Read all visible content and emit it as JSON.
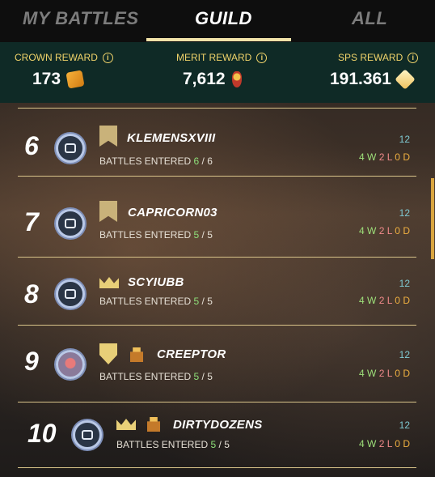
{
  "tabs": {
    "my_battles": "MY BATTLES",
    "guild": "GUILD",
    "all": "ALL",
    "active": "GUILD"
  },
  "rewards": {
    "crown": {
      "label": "CROWN REWARD",
      "value": "173",
      "icon": "crown-token-icon"
    },
    "merit": {
      "label": "MERIT REWARD",
      "value": "7,612",
      "icon": "merit-medal-icon"
    },
    "sps": {
      "label": "SPS REWARD",
      "value": "191.361",
      "icon": "sps-token-icon"
    }
  },
  "rows": [
    {
      "rank": "6",
      "name": "KLEMENSXVIII",
      "battles_label": "BATTLES ENTERED",
      "entered": "6",
      "total": "6",
      "score": "12",
      "w": "4",
      "l": "2",
      "d": "0",
      "w_suffix": "W",
      "l_suffix": "L",
      "d_suffix": "D",
      "badge": "banner-icon"
    },
    {
      "rank": "7",
      "name": "CAPRICORN03",
      "battles_label": "BATTLES ENTERED",
      "entered": "5",
      "total": "5",
      "score": "12",
      "w": "4",
      "l": "2",
      "d": "0",
      "w_suffix": "W",
      "l_suffix": "L",
      "d_suffix": "D",
      "badge": "banner-icon"
    },
    {
      "rank": "8",
      "name": "SCYIUBB",
      "battles_label": "BATTLES ENTERED",
      "entered": "5",
      "total": "5",
      "score": "12",
      "w": "4",
      "l": "2",
      "d": "0",
      "w_suffix": "W",
      "l_suffix": "L",
      "d_suffix": "D",
      "badge": "crown-icon"
    },
    {
      "rank": "9",
      "name": "CREEPTOR",
      "battles_label": "BATTLES ENTERED",
      "entered": "5",
      "total": "5",
      "score": "12",
      "w": "4",
      "l": "2",
      "d": "0",
      "w_suffix": "W",
      "l_suffix": "L",
      "d_suffix": "D",
      "badge": "shield-icon"
    },
    {
      "rank": "10",
      "name": "DIRTYDOZENS",
      "battles_label": "BATTLES ENTERED",
      "entered": "5",
      "total": "5",
      "score": "12",
      "w": "4",
      "l": "2",
      "d": "0",
      "w_suffix": "W",
      "l_suffix": "L",
      "d_suffix": "D",
      "badge": "crown-icon"
    }
  ],
  "colors": {
    "accent": "#f0e2a8",
    "reward_bar": "#0f2a26",
    "win": "#9ee07a",
    "loss": "#f08a8a",
    "draw": "#f0b040"
  }
}
